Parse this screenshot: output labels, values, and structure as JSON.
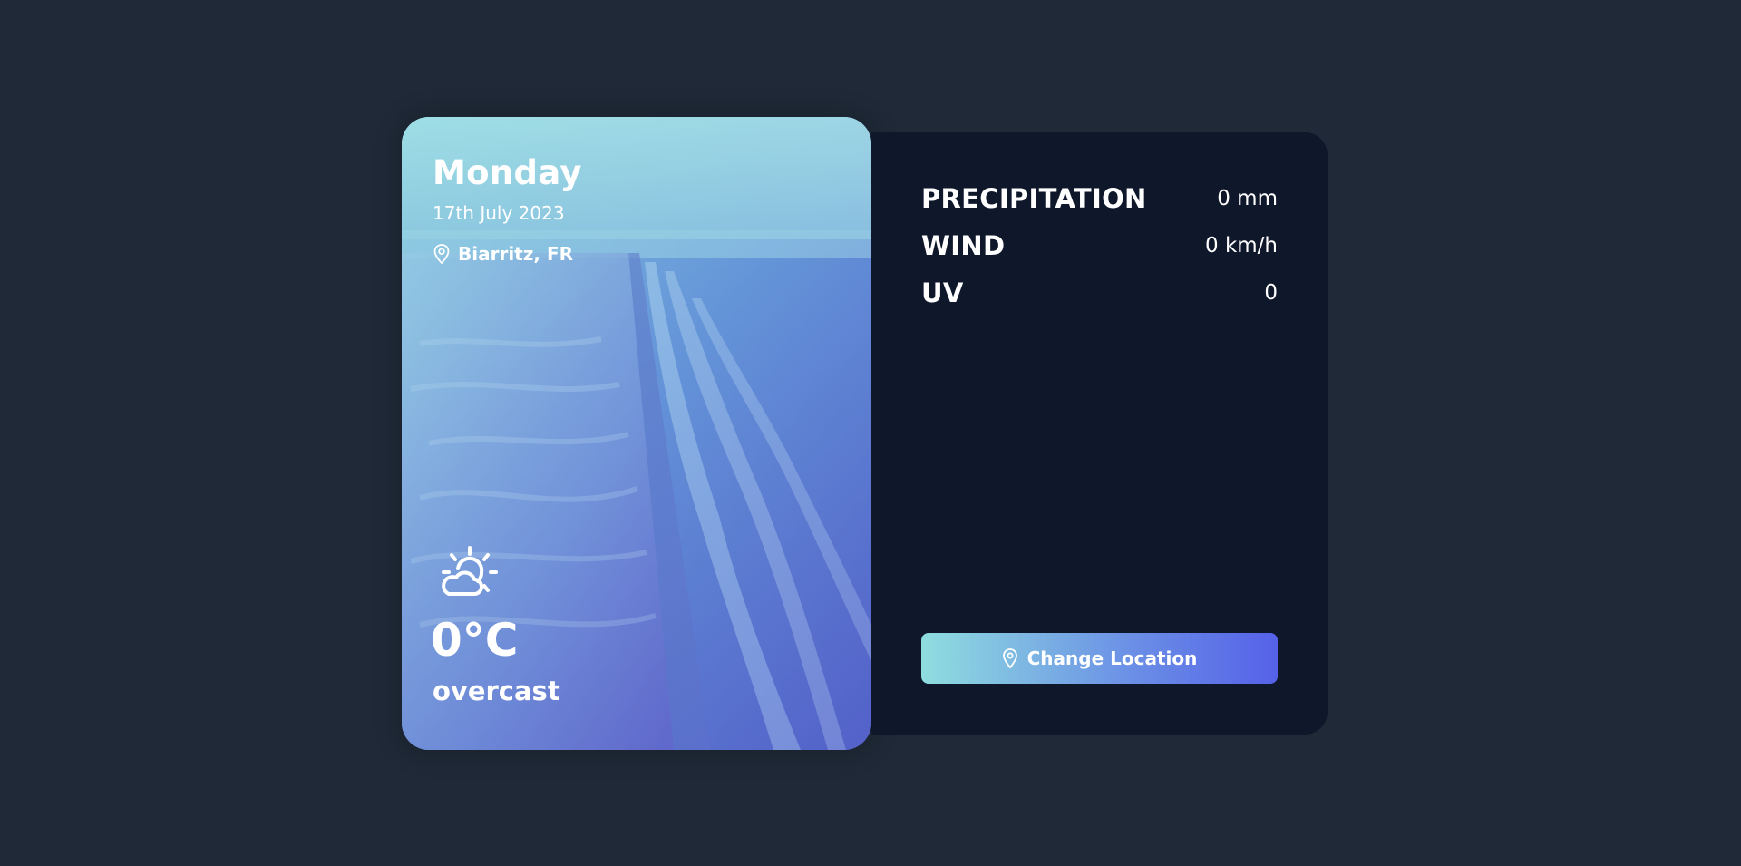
{
  "weather": {
    "day": "Monday",
    "date": "17th July 2023",
    "location": "Biarritz, FR",
    "temperature": "0°C",
    "description": "overcast",
    "icon": "partly-cloudy-sun-icon"
  },
  "details": {
    "precipitation": {
      "label": "PRECIPITATION",
      "value": "0 mm"
    },
    "wind": {
      "label": "WIND",
      "value": "0 km/h"
    },
    "uv": {
      "label": "UV",
      "value": "0"
    }
  },
  "actions": {
    "change_location_label": "Change Location",
    "change_location_icon": "location-pin-icon"
  },
  "colors": {
    "background": "#1f2937",
    "panel": "#0f172a",
    "accent_start": "#8fdddf",
    "accent_end": "#5561e8"
  }
}
